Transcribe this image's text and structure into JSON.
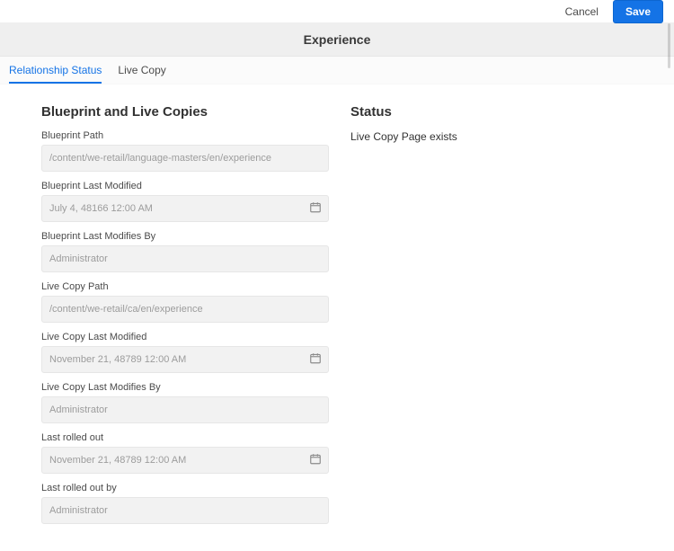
{
  "actions": {
    "cancel": "Cancel",
    "save": "Save"
  },
  "title": "Experience",
  "tabs": {
    "relationship": "Relationship Status",
    "livecopy": "Live Copy"
  },
  "left": {
    "heading": "Blueprint and Live Copies",
    "fields": {
      "bp_path_label": "Blueprint Path",
      "bp_path_value": "/content/we-retail/language-masters/en/experience",
      "bp_lastmod_label": "Blueprint Last Modified",
      "bp_lastmod_value": "July 4, 48166 12:00 AM",
      "bp_lastmodby_label": "Blueprint Last Modifies By",
      "bp_lastmodby_value": "Administrator",
      "lc_path_label": "Live Copy Path",
      "lc_path_value": "/content/we-retail/ca/en/experience",
      "lc_lastmod_label": "Live Copy Last Modified",
      "lc_lastmod_value": "November 21, 48789 12:00 AM",
      "lc_lastmodby_label": "Live Copy Last Modifies By",
      "lc_lastmodby_value": "Administrator",
      "lastroll_label": "Last rolled out",
      "lastroll_value": "November 21, 48789 12:00 AM",
      "lastrollby_label": "Last rolled out by",
      "lastrollby_value": "Administrator"
    }
  },
  "right": {
    "heading": "Status",
    "status_text": "Live Copy Page exists"
  }
}
